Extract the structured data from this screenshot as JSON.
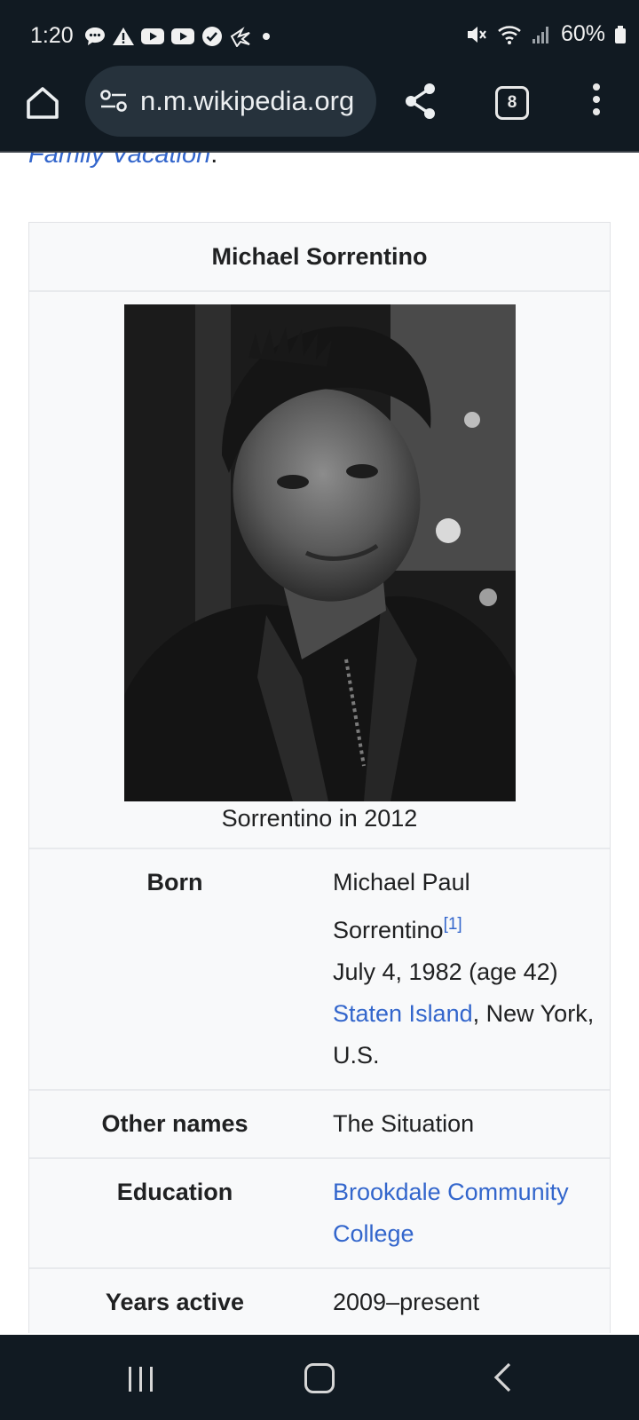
{
  "status_bar": {
    "time": "1:20",
    "battery": "60%",
    "left_icons": [
      "chat-icon",
      "alert-icon",
      "youtube-icon",
      "youtube-icon",
      "check-badge-icon",
      "bird-icon",
      "dot-icon"
    ],
    "right_icons": [
      "mute-icon",
      "wifi-icon",
      "signal-icon",
      "battery-icon"
    ]
  },
  "browser": {
    "url": "n.m.wikipedia.org",
    "tab_count": "8"
  },
  "article": {
    "prev_link": "Family Vacation",
    "prev_link_after": "."
  },
  "infobox": {
    "title": "Michael Sorrentino",
    "image_caption": "Sorrentino in 2012",
    "born": {
      "label": "Born",
      "name_line": "Michael Paul Sorrentino",
      "ref": "[1]",
      "date": "July 4, 1982 (age 42)",
      "place_link": "Staten Island",
      "place_rest": ", New York, U.S."
    },
    "other_names": {
      "label": "Other names",
      "value": "The Situation"
    },
    "education": {
      "label": "Education",
      "value": "Brookdale Community College"
    },
    "years_active": {
      "label": "Years active",
      "value": "2009–present"
    }
  },
  "colors": {
    "link": "#3366cc",
    "chrome_bg": "#111a22",
    "infobox_bg": "#f8f9fa"
  }
}
